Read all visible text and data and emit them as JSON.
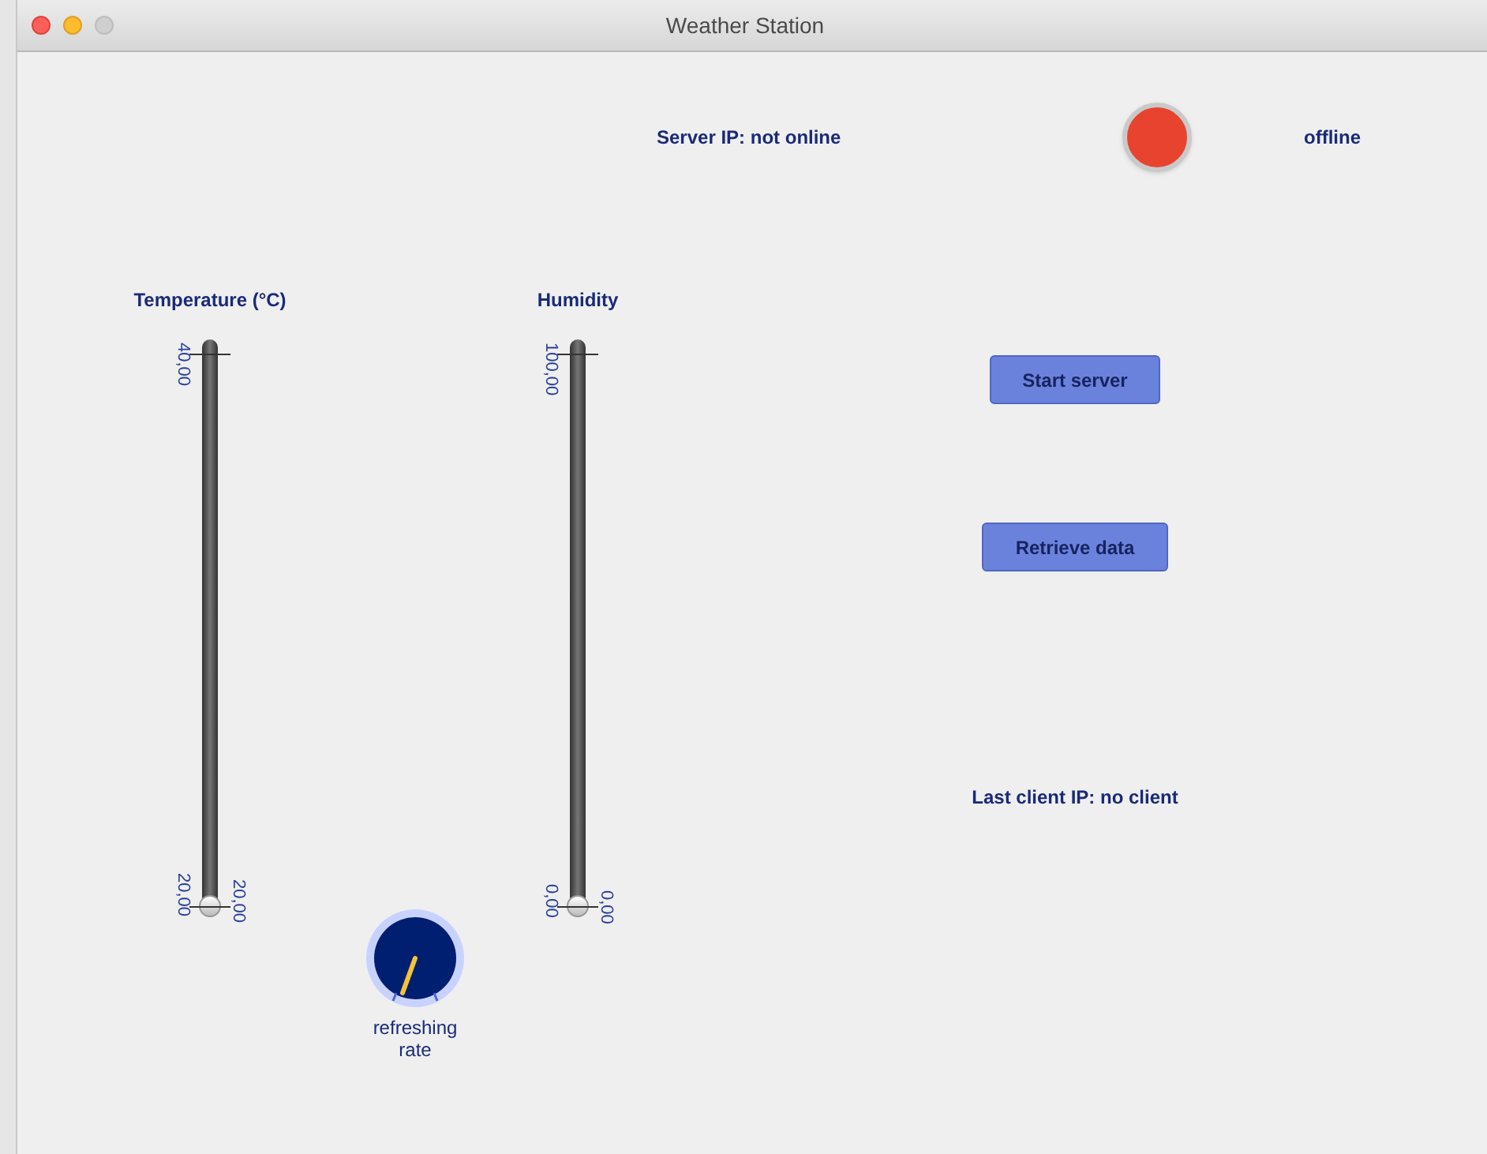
{
  "window": {
    "title": "Weather Station"
  },
  "server_ip": "Server IP: not online",
  "status": {
    "online": false,
    "label": "offline"
  },
  "sliders": [
    {
      "label": "Temperature (°C)",
      "max_label": "40,00",
      "min_label": "20,00",
      "value_label": "20,00",
      "level": 0
    },
    {
      "label": "Humidity",
      "max_label": "100,00",
      "min_label": "0,00",
      "value_label": "0,00",
      "level": 0
    }
  ],
  "dial": {
    "label": "refreshing rate"
  },
  "buttons": [
    "Start server",
    "Retrieve data"
  ],
  "last_client": "Last client IP: no client"
}
